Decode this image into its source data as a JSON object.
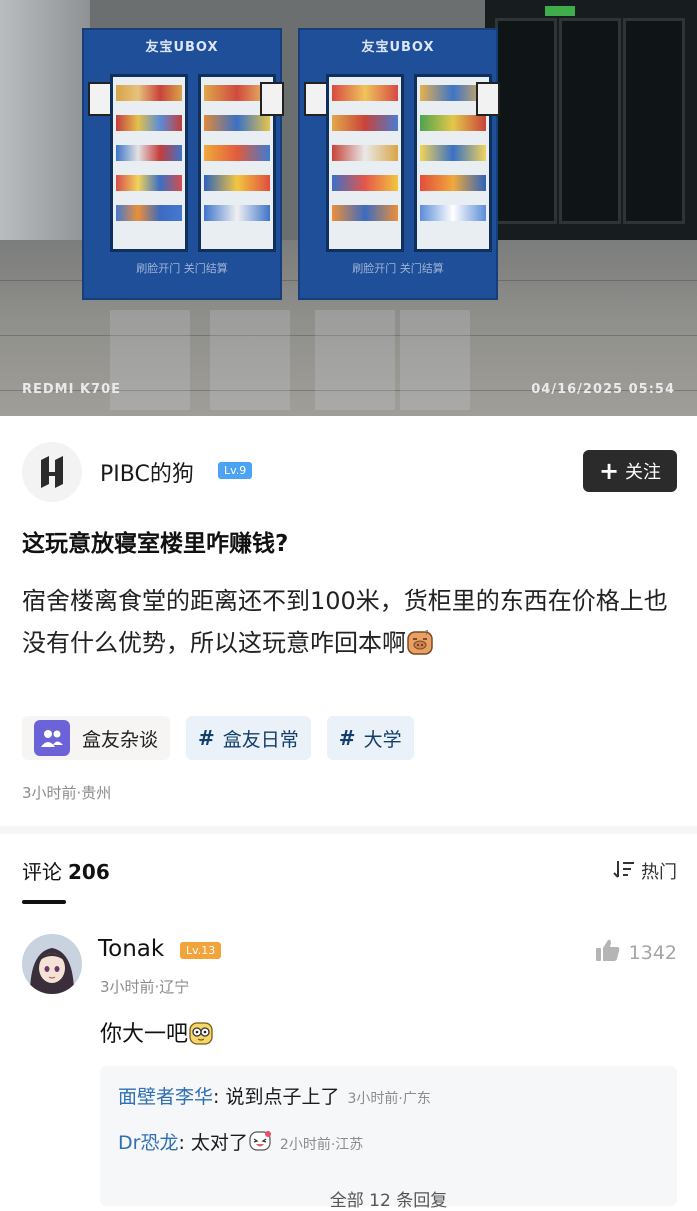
{
  "photo": {
    "brand_left": "友宝UBOX",
    "brand_right": "友宝UBOX",
    "machine_foot_left": "刷脸开门  关门结算",
    "machine_foot_right": "刷脸开门  关门结算",
    "camera_watermark": "REDMI K70E",
    "timestamp": "04/16/2025 05:54"
  },
  "author": {
    "name": "PIBC的狗",
    "level": "Lv.9",
    "follow_label": "关注",
    "logo_icon": "brand-logo-icon"
  },
  "post": {
    "title": "这玩意放寝室楼里咋赚钱?",
    "body": "宿舍楼离食堂的距离还不到100米，货柜里的东西在价格上也没有什么优势，所以这玩意咋回本啊",
    "tags": [
      {
        "label": "盒友杂谈",
        "kind": "circle"
      },
      {
        "label": "盒友日常",
        "kind": "topic"
      },
      {
        "label": "大学",
        "kind": "topic"
      }
    ],
    "meta": "3小时前·贵州"
  },
  "comments": {
    "title": "评论",
    "count": "206",
    "sort_label": "热门",
    "items": [
      {
        "name": "Tonak",
        "level": "Lv.13",
        "time": "3小时前·辽宁",
        "likes": "1342",
        "text": "你大一吧",
        "replies": [
          {
            "name": "面壁者李华",
            "text": "说到点子上了",
            "time": "3小时前·广东"
          },
          {
            "name": "Dr恐龙",
            "text": "太对了",
            "time": "2小时前·江苏"
          }
        ],
        "more_replies": "全部 12 条回复"
      }
    ]
  },
  "colors": {
    "accent_blue": "#4da3f3",
    "level_orange": "#f2a43a",
    "reply_name": "#2f6fb3",
    "follow_bg": "#2b2b2b"
  }
}
